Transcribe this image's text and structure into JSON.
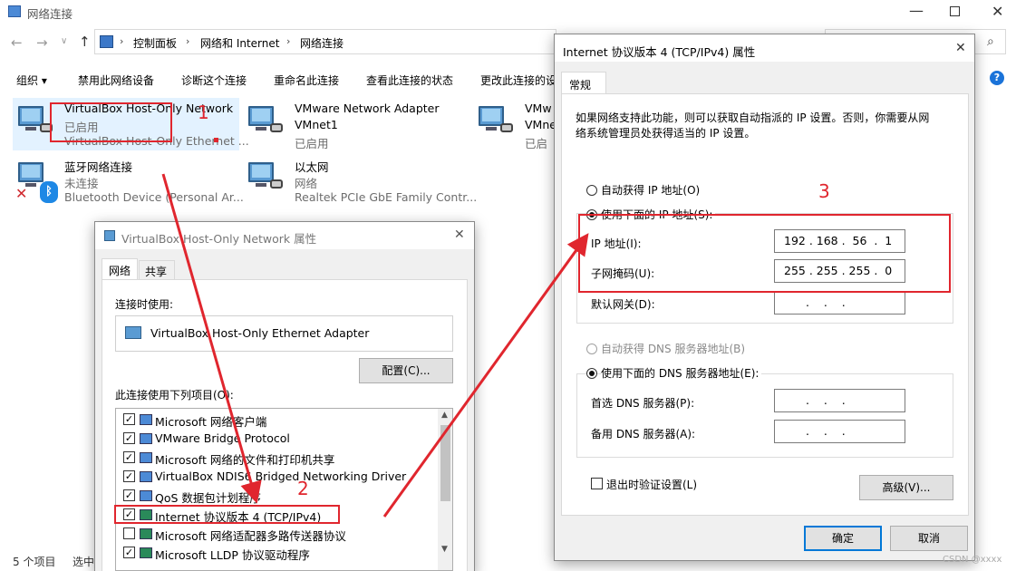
{
  "explorer": {
    "title": "网络连接",
    "breadcrumb": [
      "控制面板",
      "网络和 Internet",
      "网络连接"
    ],
    "commands": [
      "组织 ▾",
      "禁用此网络设备",
      "诊断这个连接",
      "重命名此连接",
      "查看此连接的状态",
      "更改此连接的设"
    ],
    "items": [
      {
        "name": "VirtualBox Host-Only Network",
        "status": "已启用",
        "device": "VirtualBox Host-Only Ethernet ..."
      },
      {
        "name": "VMware Network Adapter",
        "status": "VMnet1",
        "device": "已启用"
      },
      {
        "name": "VMw",
        "status": "VMne",
        "device": "已启"
      },
      {
        "name": "蓝牙网络连接",
        "status": "未连接",
        "device": "Bluetooth Device (Personal Ar..."
      },
      {
        "name": "以太网",
        "status": "网络",
        "device": "Realtek PCIe GbE Family Contr..."
      }
    ],
    "status_count": "5 个项目",
    "status_selected": "选中",
    "watermark": "CSDN @xxxx"
  },
  "vbox_dialog": {
    "title": "VirtualBox Host-Only Network 属性",
    "tabs": [
      "网络",
      "共享"
    ],
    "connect_using_label": "连接时使用:",
    "adapter": "VirtualBox Host-Only Ethernet Adapter",
    "configure_button": "配置(C)...",
    "items_label": "此连接使用下列项目(O):",
    "items": [
      "Microsoft 网络客户端",
      "VMware Bridge Protocol",
      "Microsoft 网络的文件和打印机共享",
      "VirtualBox NDIS6 Bridged Networking Driver",
      "QoS 数据包计划程序",
      "Internet 协议版本 4 (TCP/IPv4)",
      "Microsoft 网络适配器多路传送器协议",
      "Microsoft LLDP 协议驱动程序"
    ]
  },
  "ipv4_dialog": {
    "title": "Internet 协议版本 4 (TCP/IPv4) 属性",
    "tab": "常规",
    "description_line1": "如果网络支持此功能，则可以获取自动指派的 IP 设置。否则，你需要从网",
    "description_line2": "络系统管理员处获得适当的 IP 设置。",
    "auto_ip": "自动获得 IP 地址(O)",
    "manual_ip": "使用下面的 IP 地址(S):",
    "ip_label": "IP 地址(I):",
    "ip_value": "192 . 168 .  56  .  1",
    "mask_label": "子网掩码(U):",
    "mask_value": "255 . 255 . 255 .  0",
    "gateway_label": "默认网关(D):",
    "empty_ip": ".    .    .",
    "auto_dns": "自动获得 DNS 服务器地址(B)",
    "manual_dns": "使用下面的 DNS 服务器地址(E):",
    "dns1_label": "首选 DNS 服务器(P):",
    "dns2_label": "备用 DNS 服务器(A):",
    "validate_label": "退出时验证设置(L)",
    "advanced_button": "高级(V)...",
    "ok_button": "确定",
    "cancel_button": "取消"
  },
  "annotations": {
    "step1": "1",
    "step2": "2",
    "step3": "3"
  },
  "colors": {
    "accent": "#0078d7",
    "annotation": "#e0262e"
  }
}
